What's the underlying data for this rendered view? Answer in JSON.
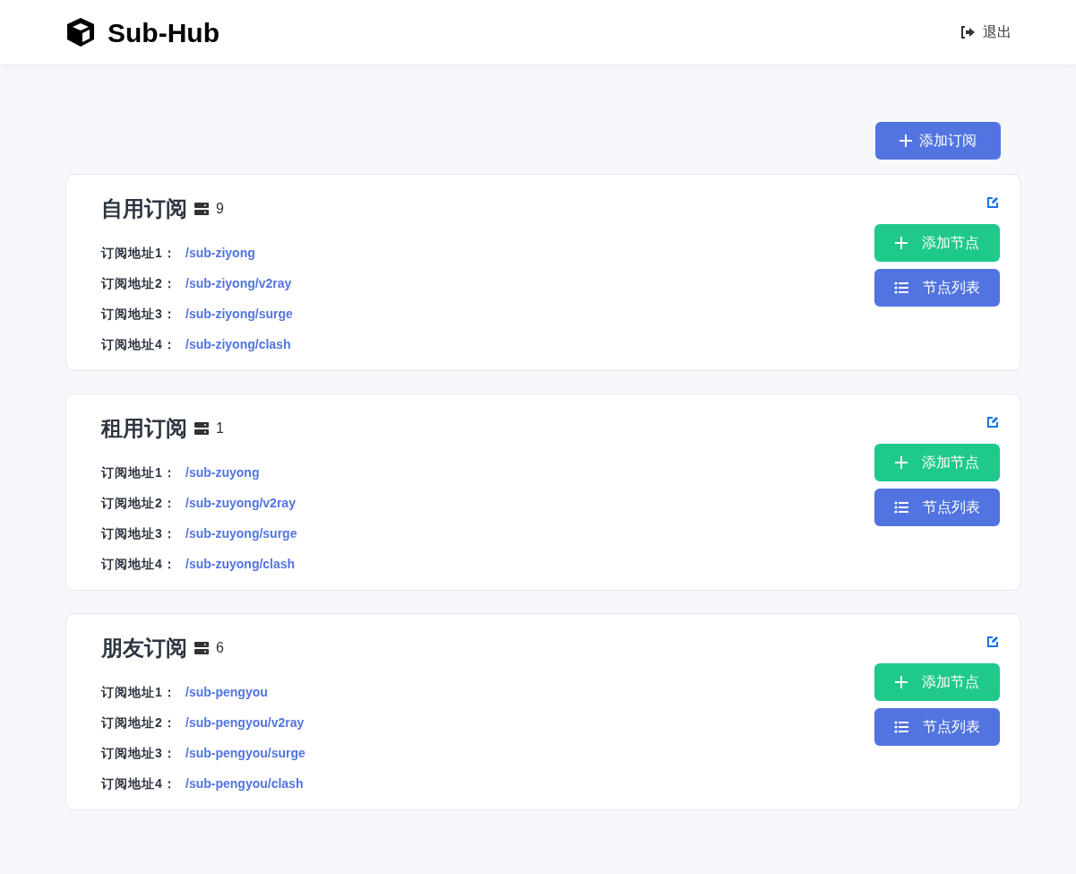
{
  "header": {
    "brand": "Sub-Hub",
    "logout": "退出"
  },
  "add_subscription_button": "添加订阅",
  "subscriptions": [
    {
      "name": "自用订阅",
      "node_count": "9",
      "addresses": [
        {
          "label": "订阅地址1：",
          "url": "/sub-ziyong"
        },
        {
          "label": "订阅地址2：",
          "url": "/sub-ziyong/v2ray"
        },
        {
          "label": "订阅地址3：",
          "url": "/sub-ziyong/surge"
        },
        {
          "label": "订阅地址4：",
          "url": "/sub-ziyong/clash"
        }
      ],
      "add_node_button": "添加节点",
      "node_list_button": "节点列表"
    },
    {
      "name": "租用订阅",
      "node_count": "1",
      "addresses": [
        {
          "label": "订阅地址1：",
          "url": "/sub-zuyong"
        },
        {
          "label": "订阅地址2：",
          "url": "/sub-zuyong/v2ray"
        },
        {
          "label": "订阅地址3：",
          "url": "/sub-zuyong/surge"
        },
        {
          "label": "订阅地址4：",
          "url": "/sub-zuyong/clash"
        }
      ],
      "add_node_button": "添加节点",
      "node_list_button": "节点列表"
    },
    {
      "name": "朋友订阅",
      "node_count": "6",
      "addresses": [
        {
          "label": "订阅地址1：",
          "url": "/sub-pengyou"
        },
        {
          "label": "订阅地址2：",
          "url": "/sub-pengyou/v2ray"
        },
        {
          "label": "订阅地址3：",
          "url": "/sub-pengyou/surge"
        },
        {
          "label": "订阅地址4：",
          "url": "/sub-pengyou/clash"
        }
      ],
      "add_node_button": "添加节点",
      "node_list_button": "节点列表"
    }
  ]
}
